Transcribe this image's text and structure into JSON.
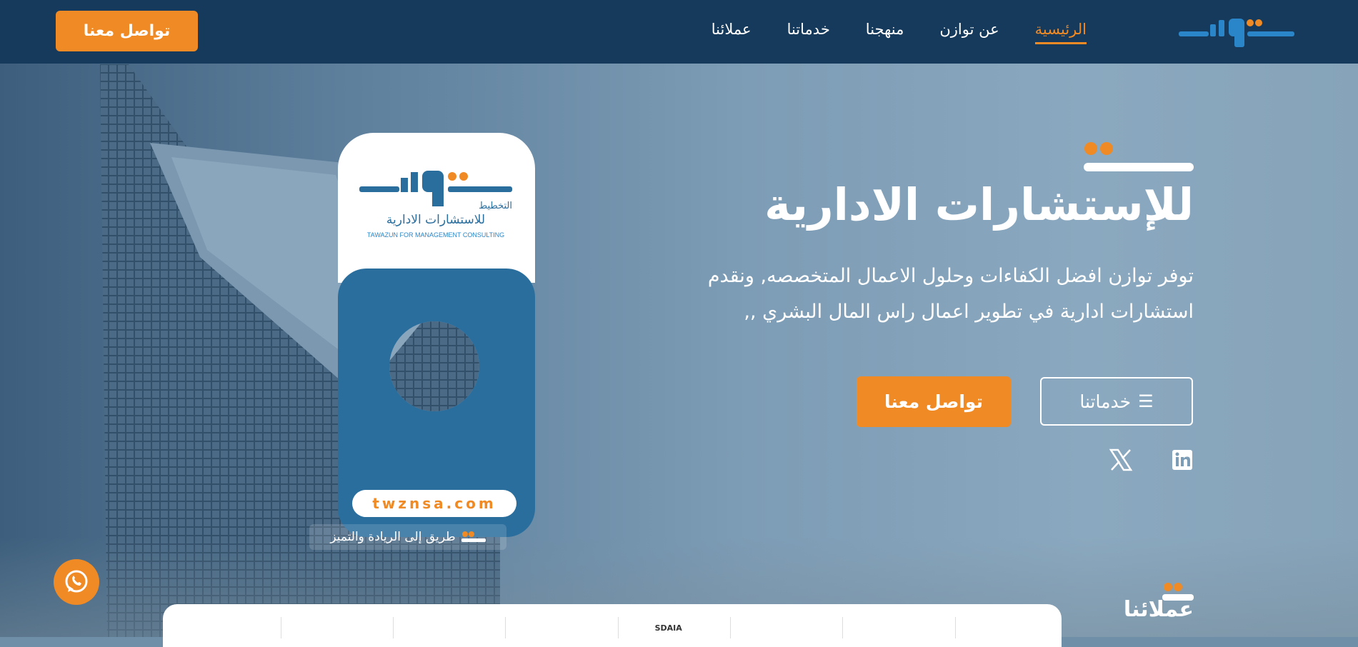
{
  "nav": {
    "brand_logo": "logo-icon",
    "links": [
      {
        "label": "الرئيسية",
        "active": true
      },
      {
        "label": "عن توازن",
        "active": false
      },
      {
        "label": "منهجنا",
        "active": false
      },
      {
        "label": "خدماتنا",
        "active": false
      },
      {
        "label": "عملائنا",
        "active": false
      }
    ],
    "cta_label": "تواصل معنا"
  },
  "hero": {
    "title": "للإستشارات الادارية",
    "subtitle": "توفر توازن افضل الكفاءات وحلول الاعمال المتخصصه, ونقدم استشارات ادارية في تطوير اعمال راس المال البشري ,,",
    "services_button": "خدماتنا",
    "contact_button": "تواصل معنا",
    "social": [
      "linkedin-icon",
      "x-icon"
    ]
  },
  "card": {
    "logo_sub": "التخطيط",
    "logo_text_ar": "للاستشارات الادارية",
    "logo_text_en": "TAWAZUN FOR MANAGEMENT CONSULTING",
    "url": "twznsa.com",
    "tagline": "طريق إلى الريادة والتميز"
  },
  "clients": {
    "title": "عملائنا",
    "logos": [
      "",
      "",
      "",
      "SDAIA",
      "",
      "",
      "",
      ""
    ]
  },
  "colors": {
    "accent": "#f08a24",
    "nav": "#163a5c",
    "brand_blue": "#2a6e9e"
  }
}
